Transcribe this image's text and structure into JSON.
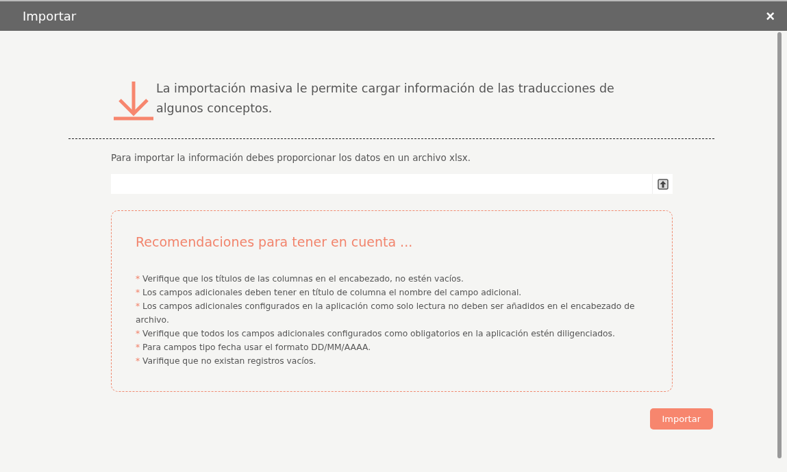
{
  "window": {
    "title": "Importar",
    "close": "×"
  },
  "intro": "La importación masiva le permite cargar información de las traducciones de algunos conceptos.",
  "instruction": "Para importar la información debes proporcionar los datos en un archivo xlsx.",
  "recommendations": {
    "title": "Recomendaciones para tener en cuenta ...",
    "items": [
      {
        "mark": "*",
        "text": "Verifique que los títulos de las columnas en el encabezado, no estén vacíos."
      },
      {
        "mark": "*",
        "text": "Los campos adicionales deben tener en título de columna el nombre del campo adicional."
      },
      {
        "mark": "*",
        "text": "Los campos adicionales configurados en la aplicación como solo lectura no deben ser añadidos en el encabezado de archivo."
      },
      {
        "mark": "*",
        "text": "Verifique que todos los campos adicionales configurados como obligatorios en la aplicación estén diligenciados."
      },
      {
        "mark": "*",
        "text": "Para campos tipo fecha usar el formato DD/MM/AAAA."
      },
      {
        "mark": "*",
        "text": "Varifique que no existan registros vacíos."
      }
    ]
  },
  "buttons": [
    "Importar"
  ]
}
